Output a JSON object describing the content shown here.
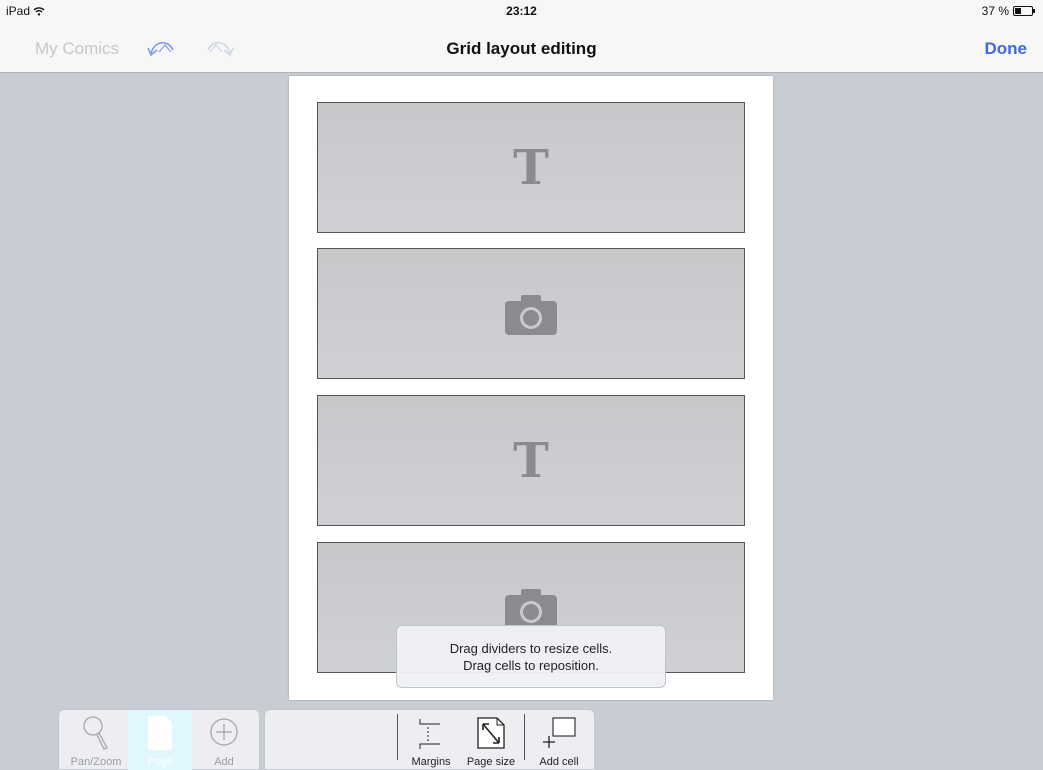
{
  "status": {
    "device": "iPad",
    "time": "23:12",
    "battery": "37 %",
    "battery_level": 0.37
  },
  "nav": {
    "back_label": "My Comics",
    "title": "Grid layout editing",
    "done_label": "Done"
  },
  "cells": [
    {
      "kind": "text",
      "glyph": "T"
    },
    {
      "kind": "photo"
    },
    {
      "kind": "text",
      "glyph": "T"
    },
    {
      "kind": "photo"
    }
  ],
  "tooltip": {
    "line1": "Drag dividers to resize cells.",
    "line2": "Drag cells to reposition."
  },
  "modes": [
    {
      "label": "Pan/Zoom",
      "icon": "magnifier-icon",
      "active": false
    },
    {
      "label": "Page",
      "icon": "page-icon",
      "active": true
    },
    {
      "label": "Add",
      "icon": "plus-circle-icon",
      "active": false
    }
  ],
  "actions": [
    {
      "label": "Margins",
      "icon": "margins-icon"
    },
    {
      "label": "Page size",
      "icon": "page-size-icon"
    },
    {
      "label": "Add cell",
      "icon": "add-cell-icon"
    }
  ],
  "colors": {
    "accent": "#3d6be0",
    "background": "#c8ccd5",
    "active_mode": "#dff7fd"
  }
}
